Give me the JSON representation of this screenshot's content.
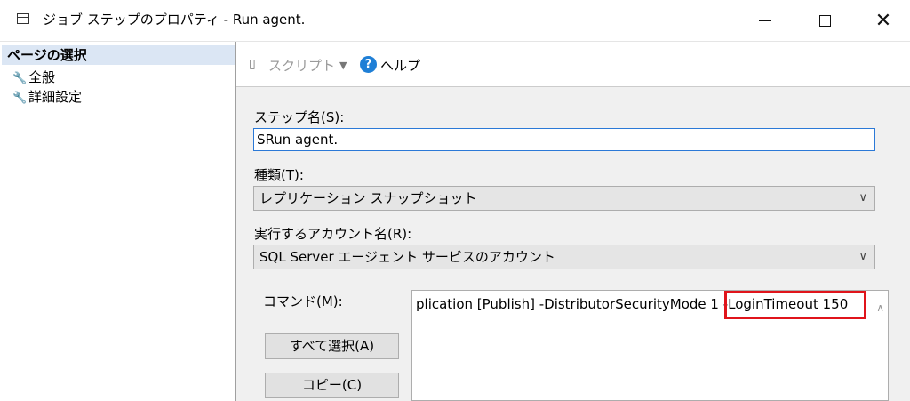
{
  "window": {
    "title": "ジョブ ステップのプロパティ - Run agent.",
    "icon": "window-icon",
    "minimize_icon": "minimize-icon",
    "maximize_icon": "maximize-icon",
    "close_icon": "close-icon"
  },
  "sidebar": {
    "header": "ページの選択",
    "items": [
      {
        "label": "全般",
        "icon": "wrench-icon"
      },
      {
        "label": "詳細設定",
        "icon": "wrench-icon"
      }
    ]
  },
  "toolbar": {
    "script_label": "スクリプト",
    "help_label": "ヘルプ",
    "help_icon_glyph": "?"
  },
  "form": {
    "step_name_label": "ステップ名(S):",
    "step_name_value": "SRun agent.",
    "type_label": "種類(T):",
    "type_value": "レプリケーション スナップショット",
    "account_label": "実行するアカウント名(R):",
    "account_value": "SQL Server エージェント サービスのアカウント",
    "command_label": "コマンド(M):",
    "command_value": "plication [Publish] -DistributorSecurityMode 1 -LoginTimeout 150",
    "select_all_button": "すべて選択(A)",
    "copy_button": "コピー(C)"
  },
  "colors": {
    "highlight_border": "#e0141b",
    "focus_border": "#2b79d7",
    "sidebar_header_bg": "#dbe6f4",
    "help_icon": "#1f7fd6"
  }
}
